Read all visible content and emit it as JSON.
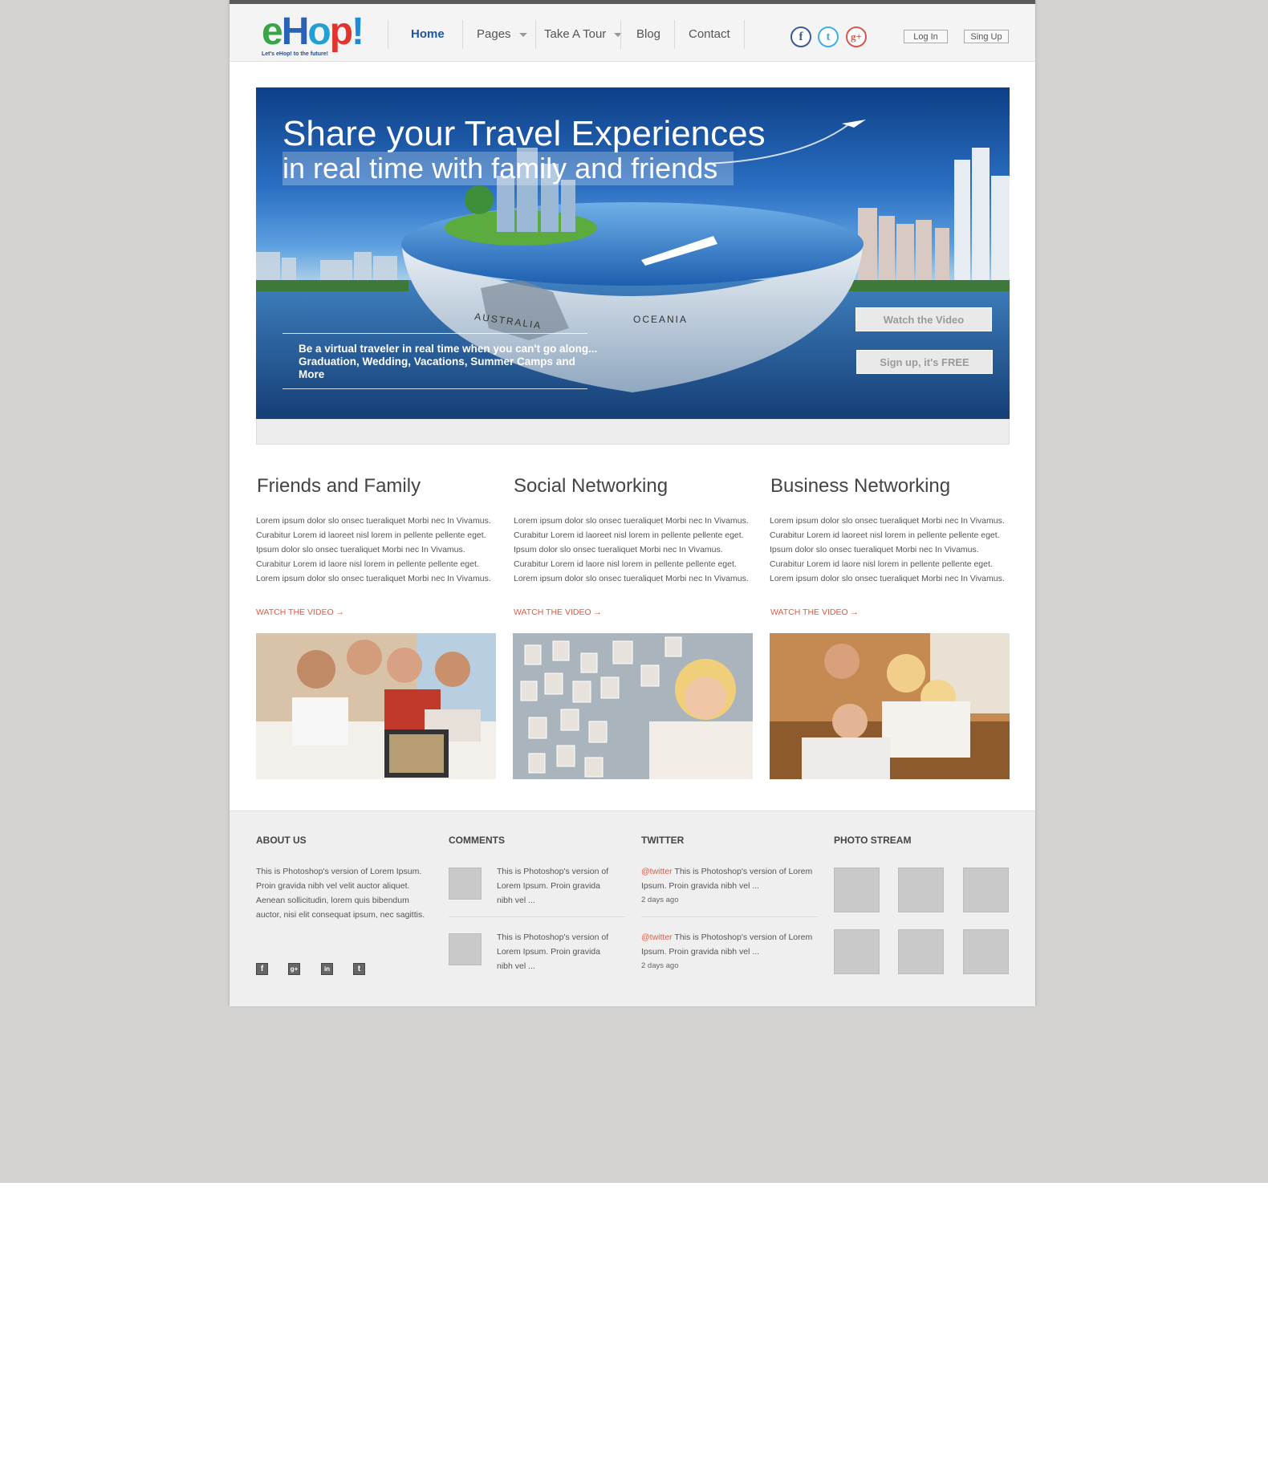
{
  "brand": {
    "logo_letters": [
      "e",
      "H",
      "o",
      "p",
      "!"
    ],
    "logo_colors": [
      "#3aa548",
      "#2a62b8",
      "#21a0d8",
      "#e3332d",
      "#1f8ad6"
    ],
    "tagline": "Let's eHop! to the future!"
  },
  "nav": {
    "items": [
      {
        "label": "Home",
        "active": true,
        "dropdown": false
      },
      {
        "label": "Pages",
        "active": false,
        "dropdown": true
      },
      {
        "label": "Take A Tour",
        "active": false,
        "dropdown": true
      },
      {
        "label": "Blog",
        "active": false,
        "dropdown": false
      },
      {
        "label": "Contact",
        "active": false,
        "dropdown": false
      }
    ]
  },
  "social": {
    "facebook": "f",
    "twitter": "t",
    "googleplus": "g+",
    "colors": {
      "facebook": "#3b5a9a",
      "twitter": "#3eaee6",
      "googleplus": "#d9574b"
    }
  },
  "auth": {
    "login": "Log In",
    "signup": "Sing Up"
  },
  "hero": {
    "title": "Share your Travel Experiences",
    "subtitle": "in real time with family and friends",
    "tagline": "Be a virtual traveler in real time when you can't go along... Graduation, Wedding, Vacations, Summer Camps and More",
    "watch_button": "Watch the Video",
    "signup_button": "Sign up, it's FREE",
    "globe_labels": [
      "AUSTRALIA",
      "OCEANIA"
    ]
  },
  "columns": [
    {
      "title": "Friends and Family",
      "body": "Lorem ipsum dolor slo onsec  tueraliquet Morbi nec In Vivamus. Curabitur Lorem id laoreet nisl lorem in pellente pellente eget. Ipsum dolor slo onsec  tueraliquet Morbi nec In Vivamus. Curabitur Lorem id laore nisl lorem in pellente pellente eget. Lorem ipsum dolor slo onsec  tueraliquet Morbi nec In Vivamus.",
      "link": "WATCH THE VIDEO →"
    },
    {
      "title": "Social Networking",
      "body": "Lorem ipsum dolor slo onsec  tueraliquet Morbi nec In Vivamus. Curabitur Lorem id laoreet nisl lorem in pellente pellente eget. Ipsum dolor slo onsec  tueraliquet Morbi nec In Vivamus. Curabitur Lorem id laore nisl lorem in pellente pellente eget. Lorem ipsum dolor slo onsec  tueraliquet Morbi nec In Vivamus.",
      "link": "WATCH THE VIDEO →"
    },
    {
      "title": "Business Networking",
      "body": "Lorem ipsum dolor slo onsec  tueraliquet Morbi nec In Vivamus. Curabitur Lorem id laoreet nisl lorem in pellente pellente eget. Ipsum dolor slo onsec  tueraliquet Morbi nec In Vivamus. Curabitur Lorem id laore nisl lorem in pellente pellente eget. Lorem ipsum dolor slo onsec  tueraliquet Morbi nec In Vivamus.",
      "link": "WATCH THE VIDEO →"
    }
  ],
  "footer": {
    "about": {
      "title": "ABOUT US",
      "text": "This is Photoshop's version  of Lorem Ipsum. Proin gravida nibh vel velit auctor aliquet. Aenean sollicitudin, lorem quis bibendum auctor, nisi elit consequat ipsum, nec sagittis.",
      "icons": [
        "f",
        "g+",
        "in",
        "t"
      ]
    },
    "comments": {
      "title": "COMMENTS",
      "items": [
        {
          "text": "This is Photoshop's version of Lorem Ipsum. Proin gravida nibh vel ..."
        },
        {
          "text": "This is Photoshop's version of Lorem Ipsum. Proin gravida nibh vel ..."
        }
      ]
    },
    "twitter": {
      "title": "TWITTER",
      "items": [
        {
          "handle": "@twitter",
          "text": " This is Photoshop's version of Lorem Ipsum. Proin gravida nibh vel ...",
          "time": "2 days ago"
        },
        {
          "handle": "@twitter",
          "text": " This is Photoshop's version of Lorem Ipsum. Proin gravida nibh vel ...",
          "time": "2 days ago"
        }
      ]
    },
    "photostream": {
      "title": "PHOTO STREAM"
    }
  }
}
